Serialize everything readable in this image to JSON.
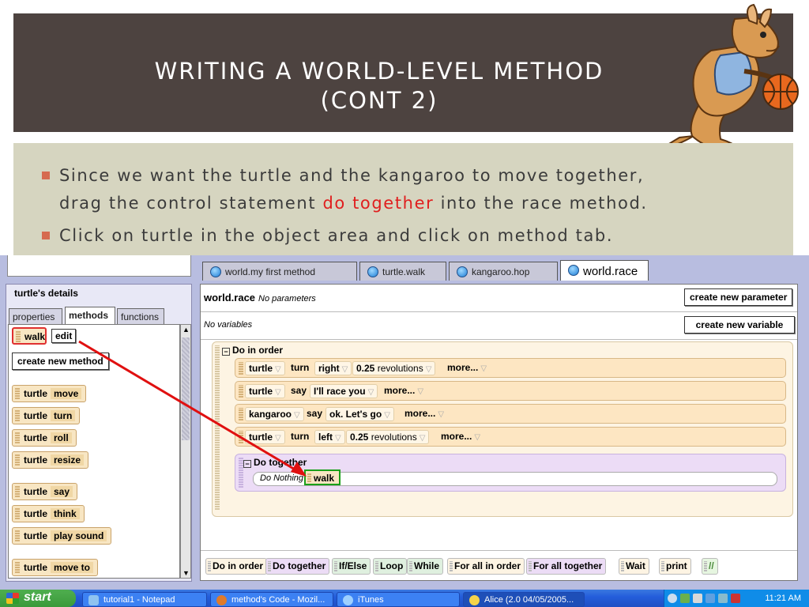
{
  "slide": {
    "title_line1": "WRITING A WORLD-LEVEL METHOD",
    "title_line2": "(CONT 2)",
    "bullets": [
      {
        "prefix": "Since we want the turtle and the kangaroo to move together,",
        "line2_a": "drag the control statement ",
        "highlight": "do together",
        "line2_b": " into the race method."
      },
      {
        "text": "Click on turtle in the object area and click on method tab."
      }
    ],
    "colors": {
      "title_band": "#4d4340",
      "bullet_area": "#d6d5c0",
      "bullet_marker": "#d66b50",
      "highlight": "#e01e1e"
    }
  },
  "alice": {
    "details_title": "turtle's details",
    "tabs": [
      "properties",
      "methods",
      "functions"
    ],
    "active_tab": "methods",
    "walk_label": "walk",
    "edit_label": "edit",
    "create_method_label": "create new method",
    "methods": [
      {
        "obj": "turtle",
        "name": "move"
      },
      {
        "obj": "turtle",
        "name": "turn"
      },
      {
        "obj": "turtle",
        "name": "roll"
      },
      {
        "obj": "turtle",
        "name": "resize"
      },
      {
        "obj": "turtle",
        "name": "say"
      },
      {
        "obj": "turtle",
        "name": "think"
      },
      {
        "obj": "turtle",
        "name": "play sound"
      },
      {
        "obj": "turtle",
        "name": "move to"
      }
    ],
    "editor_tabs": [
      "world.my first method",
      "turtle.walk",
      "kangaroo.hop",
      "world.race"
    ],
    "active_editor_tab": "world.race",
    "method_name": "world.race",
    "no_params": "No parameters",
    "create_param_label": "create new parameter",
    "no_vars": "No variables",
    "create_var_label": "create new variable",
    "do_in_order": "Do in order",
    "statements": [
      {
        "obj": "turtle",
        "verb": "turn",
        "arg": "right",
        "amount": "0.25",
        "unit": "revolutions",
        "more": "more..."
      },
      {
        "obj": "turtle",
        "verb": "say",
        "arg": "I'll race you",
        "more": "more..."
      },
      {
        "obj": "kangaroo",
        "verb": "say",
        "arg": "ok. Let's go",
        "more": "more..."
      },
      {
        "obj": "turtle",
        "verb": "turn",
        "arg": "left",
        "amount": "0.25",
        "unit": "revolutions",
        "more": "more..."
      }
    ],
    "do_together": "Do together",
    "do_nothing": "Do Nothing",
    "dragged_label": "walk",
    "controls": [
      "Do in order",
      "Do together",
      "If/Else",
      "Loop",
      "While",
      "For all in order",
      "For all together",
      "Wait",
      "print",
      "//"
    ]
  },
  "taskbar": {
    "start": "start",
    "tasks": [
      "tutorial1 - Notepad",
      "method's Code - Mozil...",
      "iTunes",
      "Alice (2.0 04/05/2005..."
    ],
    "clock": "11:21 AM"
  }
}
